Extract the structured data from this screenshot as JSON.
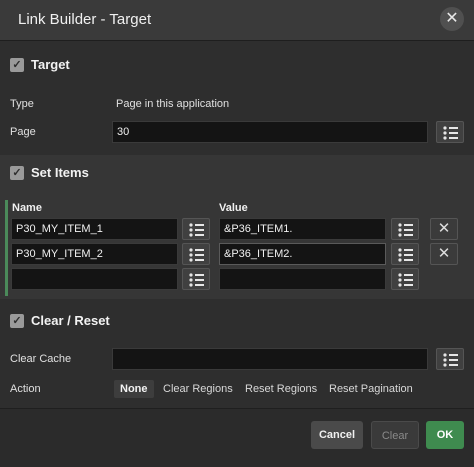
{
  "dialog": {
    "title": "Link Builder - Target"
  },
  "target": {
    "section_title": "Target",
    "type_label": "Type",
    "type_value": "Page in this application",
    "page_label": "Page",
    "page_value": "30"
  },
  "set_items": {
    "section_title": "Set Items",
    "name_header": "Name",
    "value_header": "Value",
    "rows": [
      {
        "name": "P30_MY_ITEM_1",
        "value": "&P36_ITEM1."
      },
      {
        "name": "P30_MY_ITEM_2",
        "value": "&P36_ITEM2."
      },
      {
        "name": "",
        "value": ""
      }
    ]
  },
  "clear_reset": {
    "section_title": "Clear / Reset",
    "clear_cache_label": "Clear Cache",
    "clear_cache_value": "",
    "action_label": "Action",
    "actions": [
      "None",
      "Clear Regions",
      "Reset Regions",
      "Reset Pagination"
    ],
    "selected_action": "None"
  },
  "footer": {
    "cancel_label": "Cancel",
    "clear_label": "Clear",
    "ok_label": "OK"
  },
  "colors": {
    "accent_green": "#3f8b4f",
    "background": "#2e2e2e"
  }
}
